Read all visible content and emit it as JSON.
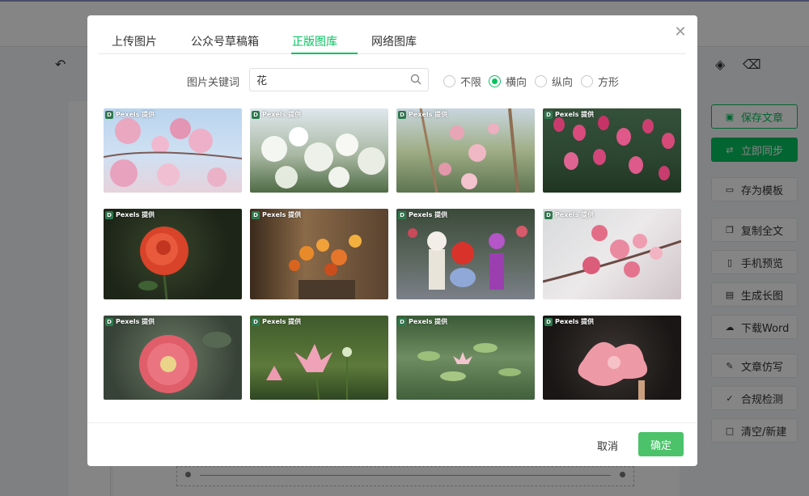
{
  "dialog": {
    "tabs": [
      {
        "label": "上传图片"
      },
      {
        "label": "公众号草稿箱"
      },
      {
        "label": "正版图库"
      },
      {
        "label": "网络图库"
      }
    ],
    "active_tab": "正版图库",
    "keyword_label": "图片关键词",
    "search_value": "花",
    "orientation_options": [
      {
        "label": "不限",
        "checked": false
      },
      {
        "label": "横向",
        "checked": true
      },
      {
        "label": "纵向",
        "checked": false
      },
      {
        "label": "方形",
        "checked": false
      }
    ],
    "image_badge": "Pexels 提供",
    "cancel_label": "取消",
    "ok_label": "确定"
  },
  "side_panel": {
    "save_article": "保存文章",
    "sync_now": "立即同步",
    "save_template": "存为模板",
    "copy_all": "复制全文",
    "mobile_preview": "手机预览",
    "long_image": "生成长图",
    "download_word": "下载Word",
    "imitate": "文章仿写",
    "compliance": "合规检测",
    "clear_new": "清空/新建"
  },
  "images": [
    {
      "subject": "pink-magnolia-sky"
    },
    {
      "subject": "white-blossoms"
    },
    {
      "subject": "magnolia-tree"
    },
    {
      "subject": "pink-tulips"
    },
    {
      "subject": "red-rose-dark"
    },
    {
      "subject": "orange-flowers-pot"
    },
    {
      "subject": "flower-market-bouquets"
    },
    {
      "subject": "pink-cherry-blossom"
    },
    {
      "subject": "pink-hollyhock"
    },
    {
      "subject": "pink-lotus"
    },
    {
      "subject": "water-lily-pond"
    },
    {
      "subject": "pink-hibiscus-dark"
    }
  ]
}
